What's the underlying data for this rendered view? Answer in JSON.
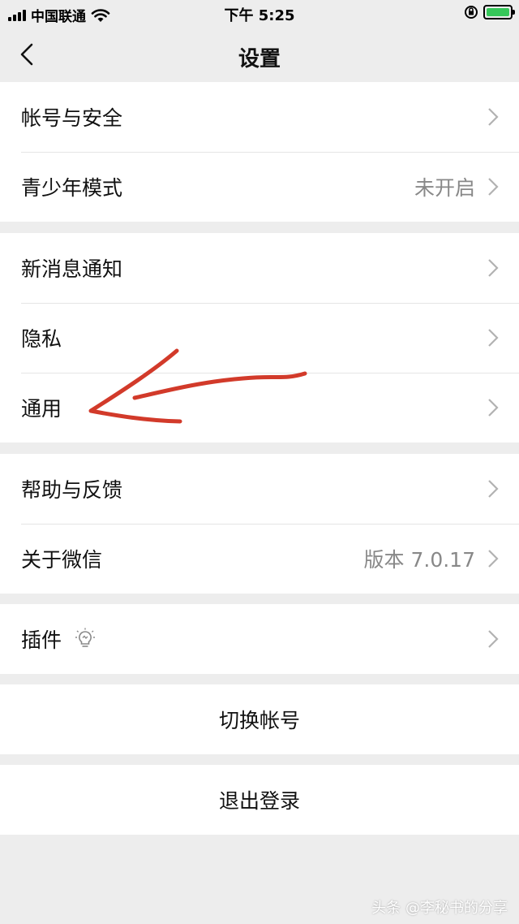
{
  "status_bar": {
    "carrier": "中国联通",
    "time": "下午 5:25",
    "battery_color": "#35c759"
  },
  "nav": {
    "title": "设置",
    "back_icon": "chevron-left-icon"
  },
  "groups": [
    {
      "rows": [
        {
          "label": "帐号与安全",
          "value": ""
        },
        {
          "label": "青少年模式",
          "value": "未开启"
        }
      ]
    },
    {
      "rows": [
        {
          "label": "新消息通知",
          "value": ""
        },
        {
          "label": "隐私",
          "value": ""
        },
        {
          "label": "通用",
          "value": ""
        }
      ]
    },
    {
      "rows": [
        {
          "label": "帮助与反馈",
          "value": ""
        },
        {
          "label": "关于微信",
          "value": "版本 7.0.17"
        }
      ]
    },
    {
      "rows": [
        {
          "label": "插件",
          "value": "",
          "icon": "lightbulb-icon"
        }
      ]
    }
  ],
  "actions": {
    "switch_account": "切换帐号",
    "logout": "退出登录"
  },
  "annotation": {
    "arrow_color": "#d23a2a",
    "points_to": "通用"
  },
  "watermark": "头条 @李秘书的分享"
}
